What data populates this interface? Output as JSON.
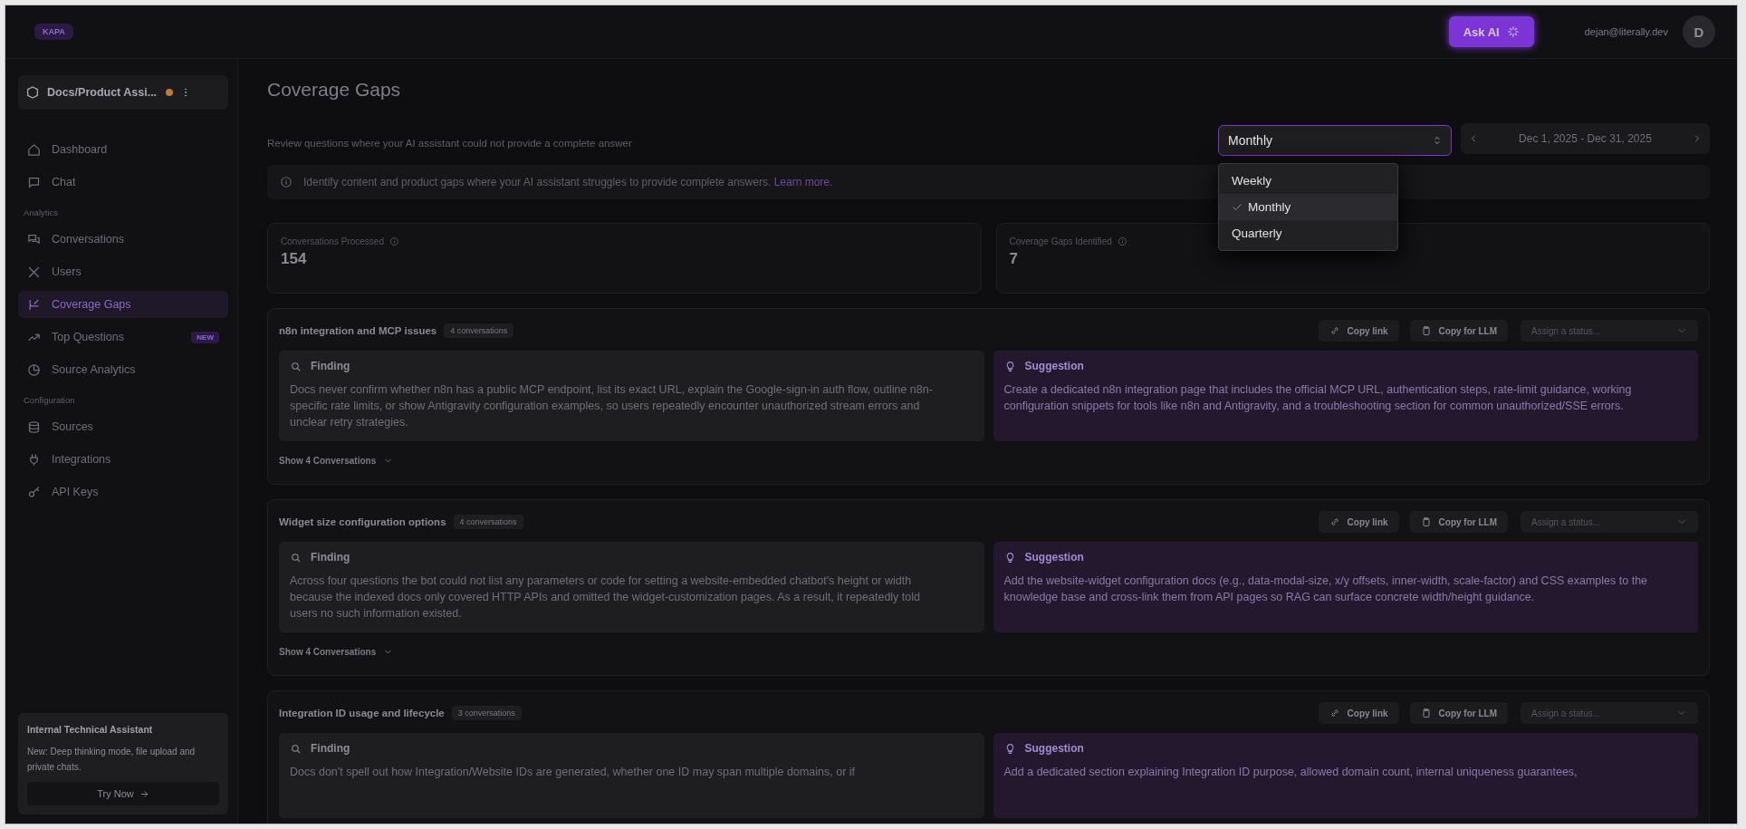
{
  "header": {
    "logo": "KAPA",
    "ask_ai": "Ask AI",
    "email": "dejan@literally.dev",
    "avatar": "D"
  },
  "sidebar": {
    "project": "Docs/Product Assi...",
    "sections": [
      {
        "items": [
          {
            "label": "Dashboard",
            "selected": false
          },
          {
            "label": "Chat",
            "selected": false
          }
        ]
      },
      {
        "title": "Analytics",
        "items": [
          {
            "label": "Conversations",
            "selected": false
          },
          {
            "label": "Users",
            "selected": false
          },
          {
            "label": "Coverage Gaps",
            "selected": true
          },
          {
            "label": "Top Questions",
            "selected": false,
            "badge": "NEW"
          },
          {
            "label": "Source Analytics",
            "selected": false
          }
        ]
      },
      {
        "title": "Configuration",
        "items": [
          {
            "label": "Sources",
            "selected": false
          },
          {
            "label": "Integrations",
            "selected": false
          },
          {
            "label": "API Keys",
            "selected": false
          }
        ]
      }
    ],
    "promo": {
      "title": "Internal Technical Assistant",
      "text": "New: Deep thinking mode, file upload and private chats.",
      "button": "Try Now"
    }
  },
  "page": {
    "title": "Coverage Gaps",
    "subtitle": "Review questions where your AI assistant could not provide a complete answer",
    "period_select": {
      "value": "Monthly",
      "options": [
        {
          "label": "Weekly",
          "selected": false
        },
        {
          "label": "Monthly",
          "selected": true
        },
        {
          "label": "Quarterly",
          "selected": false
        }
      ]
    },
    "date_range": "Dec 1, 2025 - Dec 31, 2025",
    "info": {
      "text": "Identify content and product gaps where your AI assistant struggles to provide complete answers.",
      "link": "Learn more."
    },
    "stats": [
      {
        "label": "Conversations Processed",
        "value": "154"
      },
      {
        "label": "Coverage Gaps Identified",
        "value": "7"
      }
    ],
    "gaps": [
      {
        "title": "n8n integration and MCP issues",
        "count": "4 conversations",
        "copy_link": "Copy link",
        "copy_llm": "Copy for LLM",
        "status_placeholder": "Assign a status...",
        "finding_heading": "Finding",
        "finding": "Docs never confirm whether n8n has a public MCP endpoint, list its exact URL, explain the Google-sign-in auth flow, outline n8n-specific rate limits, or show Antigravity configuration examples, so users repeatedly encounter unauthorized stream errors and unclear retry strategies.",
        "suggestion_heading": "Suggestion",
        "suggestion": "Create a dedicated n8n integration page that includes the official MCP URL, authentication steps, rate-limit guidance, working configuration snippets for tools like n8n and Antigravity, and a troubleshooting section for common unauthorized/SSE errors.",
        "toggle": "Show 4 Conversations"
      },
      {
        "title": "Widget size configuration options",
        "count": "4 conversations",
        "copy_link": "Copy link",
        "copy_llm": "Copy for LLM",
        "status_placeholder": "Assign a status...",
        "finding_heading": "Finding",
        "finding": "Across four questions the bot could not list any parameters or code for setting a website-embedded chatbot's height or width because the indexed docs only covered HTTP APIs and omitted the widget-customization pages. As a result, it repeatedly told users no such information existed.",
        "suggestion_heading": "Suggestion",
        "suggestion": "Add the website-widget configuration docs (e.g., data-modal-size, x/y offsets, inner-width, scale-factor) and CSS examples to the knowledge base and cross-link them from API pages so RAG can surface concrete width/height guidance.",
        "toggle": "Show 4 Conversations"
      },
      {
        "title": "Integration ID usage and lifecycle",
        "count": "3 conversations",
        "copy_link": "Copy link",
        "copy_llm": "Copy for LLM",
        "status_placeholder": "Assign a status...",
        "finding_heading": "Finding",
        "finding": "Docs don't spell out how Integration/Website IDs are generated, whether one ID may span multiple domains, or if",
        "suggestion_heading": "Suggestion",
        "suggestion": "Add a dedicated section explaining Integration ID purpose, allowed domain count, internal uniqueness guarantees,"
      }
    ]
  }
}
